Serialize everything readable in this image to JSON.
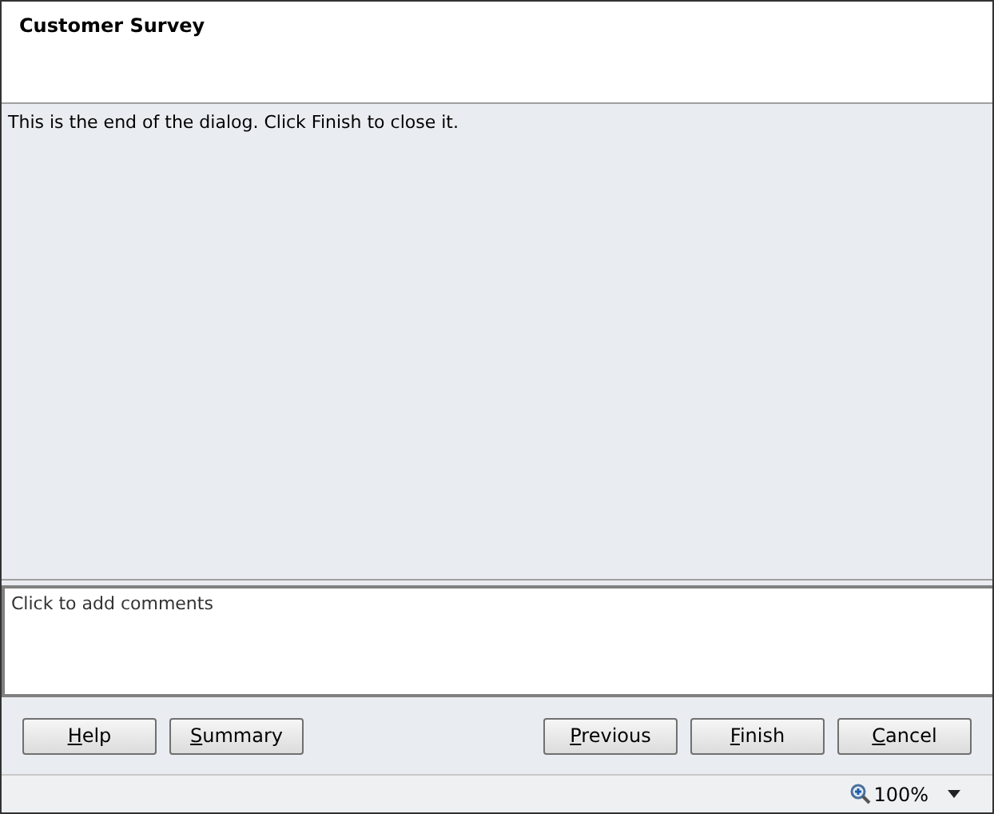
{
  "window": {
    "title": "Customer Survey"
  },
  "message": "This is the end of the dialog. Click Finish to close it.",
  "comments": {
    "placeholder": "Click to add comments"
  },
  "buttons_left": [
    {
      "label": "Help"
    },
    {
      "label": "Summary"
    }
  ],
  "buttons_right": [
    {
      "label": "Previous"
    },
    {
      "label": "Finish"
    },
    {
      "label": "Cancel"
    }
  ],
  "status_bar": {
    "zoom": "100%"
  }
}
